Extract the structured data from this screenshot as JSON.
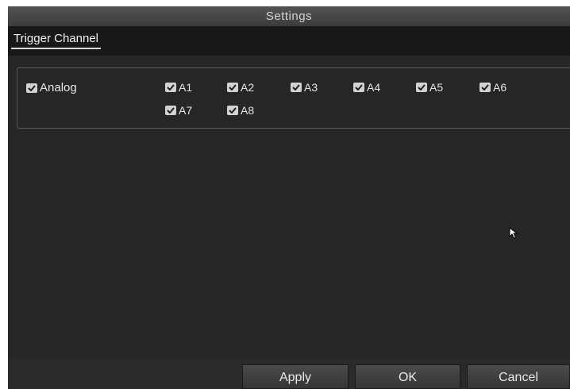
{
  "window": {
    "title": "Settings"
  },
  "tabs": [
    {
      "label": "Trigger Channel",
      "active": true
    }
  ],
  "trigger": {
    "group": {
      "label": "Analog",
      "checked": true
    },
    "channels": [
      {
        "label": "A1",
        "checked": true
      },
      {
        "label": "A2",
        "checked": true
      },
      {
        "label": "A3",
        "checked": true
      },
      {
        "label": "A4",
        "checked": true
      },
      {
        "label": "A5",
        "checked": true
      },
      {
        "label": "A6",
        "checked": true
      },
      {
        "label": "A7",
        "checked": true
      },
      {
        "label": "A8",
        "checked": true
      }
    ]
  },
  "buttons": {
    "apply": "Apply",
    "ok": "OK",
    "cancel": "Cancel"
  },
  "icons": {
    "checkbox": "checkmark-icon",
    "pointer": "mouse-pointer-icon"
  },
  "colors": {
    "background": "#262626",
    "title_bar": "#4a4a4a",
    "checkbox": "#d2d2d2",
    "text": "#e6e6e6"
  }
}
